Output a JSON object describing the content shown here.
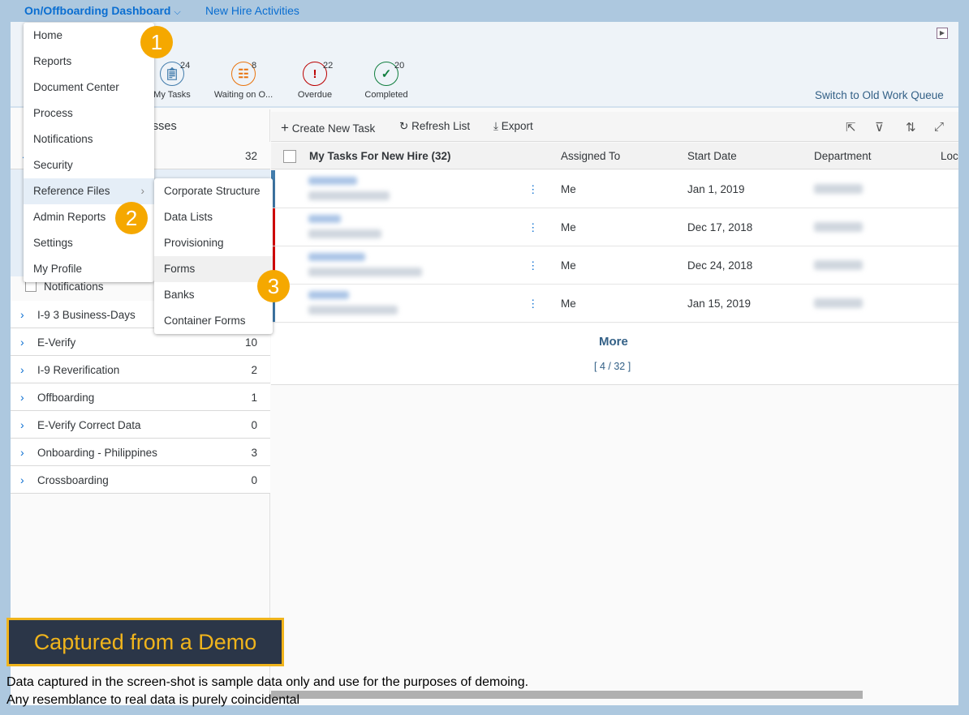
{
  "nav": {
    "dashboard": "On/Offboarding Dashboard",
    "dashboard_chevron": "⌵",
    "new_hire": "New Hire Activities"
  },
  "stats": [
    {
      "label": "My Tasks",
      "count": "24",
      "color": "#427cac",
      "icon": "clipboard-icon"
    },
    {
      "label": "Waiting on O...",
      "count": "8",
      "color": "#e9730c",
      "icon": "clipboard-person-icon"
    },
    {
      "label": "Overdue",
      "count": "22",
      "color": "#bb0000",
      "icon": "exclamation-icon"
    },
    {
      "label": "Completed",
      "count": "20",
      "color": "#107e3e",
      "icon": "check-icon"
    }
  ],
  "switch_link": "Switch to Old Work Queue",
  "left": {
    "header": "Processes",
    "top_count": "32",
    "notifications": "Notifications",
    "rows": [
      {
        "label": "I-9 3 Business-Days",
        "count": ""
      },
      {
        "label": "E-Verify",
        "count": "10"
      },
      {
        "label": "I-9 Reverification",
        "count": "2"
      },
      {
        "label": "Offboarding",
        "count": "1"
      },
      {
        "label": "E-Verify Correct Data",
        "count": "0"
      },
      {
        "label": "Onboarding - Philippines",
        "count": "3"
      },
      {
        "label": "Crossboarding",
        "count": "0"
      }
    ]
  },
  "toolbar": {
    "create": "Create New Task",
    "refresh": "Refresh List",
    "export": "Export"
  },
  "table": {
    "title": "My Tasks For New Hire (32)",
    "columns": [
      "Assigned To",
      "Start Date",
      "Department",
      "Loc"
    ],
    "rows": [
      {
        "assigned": "Me",
        "start": "Jan 1, 2019",
        "status_color": "#427cac"
      },
      {
        "assigned": "Me",
        "start": "Dec 17, 2018",
        "status_color": "#e00000"
      },
      {
        "assigned": "Me",
        "start": "Dec 24, 2018",
        "status_color": "#e00000"
      },
      {
        "assigned": "Me",
        "start": "Jan 15, 2019",
        "status_color": "#427cac"
      }
    ],
    "more": "More",
    "paging": "[ 4 / 32 ]"
  },
  "menu": {
    "items": [
      "Home",
      "Reports",
      "Document Center",
      "Process",
      "Notifications",
      "Security",
      "Reference Files",
      "Admin Reports",
      "Settings",
      "My Profile"
    ],
    "submenu": [
      "Corporate Structure",
      "Data Lists",
      "Provisioning",
      "Forms",
      "Banks",
      "Container Forms"
    ]
  },
  "badges": [
    "1",
    "2",
    "3"
  ],
  "demo": {
    "banner": "Captured from a Demo",
    "line1": "Data captured in the screen-shot is sample data only and use for the purposes of demoing.",
    "line2": "Any resemblance to real data is purely coincidental"
  }
}
